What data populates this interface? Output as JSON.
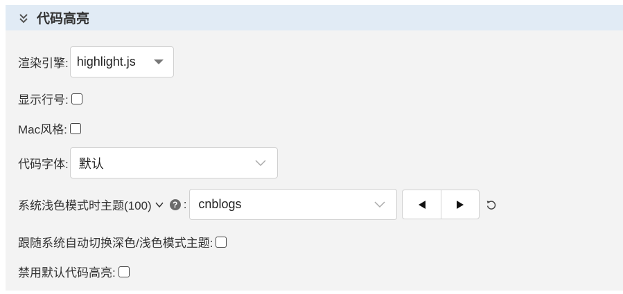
{
  "panel": {
    "title": "代码高亮",
    "header_icon": "double-chevron-down-icon"
  },
  "engine": {
    "label": "渲染引擎:",
    "value": "highlight.js"
  },
  "line_numbers": {
    "label": "显示行号:",
    "checked": false
  },
  "mac_style": {
    "label": "Mac风格:",
    "checked": false
  },
  "code_font": {
    "label": "代码字体:",
    "value": "默认"
  },
  "light_theme": {
    "label": "系统浅色模式时主题(100)",
    "dropdown_icon": "chevron-down-icon",
    "help_glyph": "?",
    "colon": ":",
    "value": "cnblogs",
    "prev_icon": "triangle-left-icon",
    "next_icon": "triangle-right-icon",
    "reset_icon": "reset-icon"
  },
  "follow_system": {
    "label": "跟随系统自动切换深色/浅色模式主题:",
    "checked": false
  },
  "disable_default": {
    "label": "禁用默认代码高亮:",
    "checked": false
  }
}
